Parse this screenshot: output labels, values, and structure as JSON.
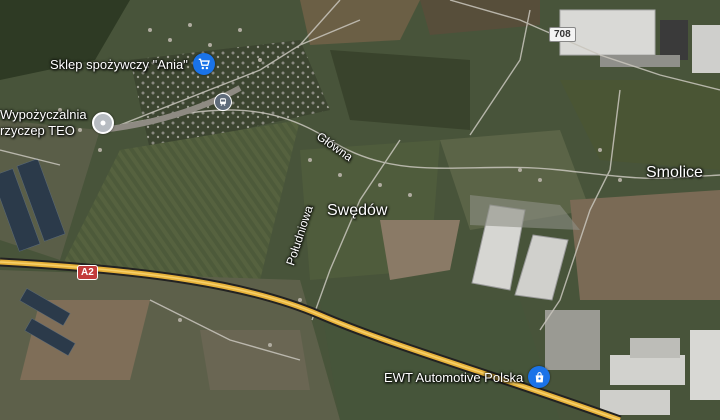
{
  "map": {
    "type": "satellite",
    "places": {
      "swedow": "Swędów",
      "smolice": "Smolice"
    },
    "pois": {
      "shop": {
        "name": "Sklep spożywczy \"Ania\"",
        "icon": "shopping-cart-icon",
        "color": "#1a73e8"
      },
      "rental_line1": "Wypożyczalnia",
      "rental_line2": "rzyczep TEO",
      "rental_icon": "location-pin-icon",
      "ewt": {
        "name": "EWT Automotive Polska",
        "icon": "shopping-bag-icon",
        "color": "#1a73e8"
      }
    },
    "streets": {
      "glowna": "Główna",
      "poludniowa": "Południowa"
    },
    "roads": {
      "route_708": "708",
      "a2": "A2"
    },
    "transit_icon": "train-station-icon"
  }
}
